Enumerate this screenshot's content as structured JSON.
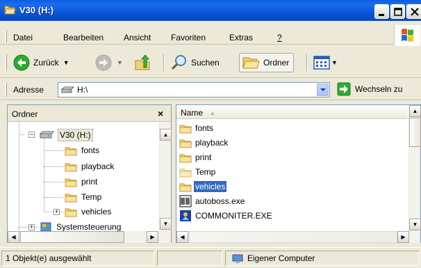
{
  "window": {
    "title": "V30 (H:)"
  },
  "colors": {
    "titlebar": "#0a55d8",
    "selection": "#316ac5",
    "chrome": "#ece9d8"
  },
  "menu": {
    "items": [
      "Datei",
      "Bearbeiten",
      "Ansicht",
      "Favoriten",
      "Extras",
      "?"
    ]
  },
  "toolbar": {
    "back_label": "Zurück",
    "search_label": "Suchen",
    "folders_label": "Ordner"
  },
  "address": {
    "label": "Adresse",
    "value": "H:\\",
    "go_label": "Wechseln zu"
  },
  "folder_pane": {
    "title": "Ordner",
    "close_label": "×",
    "tree": [
      {
        "label": "V30 (H:)",
        "icon": "drive-icon",
        "selected": true
      },
      {
        "label": "fonts",
        "icon": "folder-icon"
      },
      {
        "label": "playback",
        "icon": "folder-icon"
      },
      {
        "label": "print",
        "icon": "folder-icon"
      },
      {
        "label": "Temp",
        "icon": "folder-icon"
      },
      {
        "label": "vehicles",
        "icon": "folder-icon"
      },
      {
        "label": "Systemsteuerung",
        "icon": "control-panel-icon"
      }
    ]
  },
  "file_pane": {
    "column_name": "Name",
    "files": [
      {
        "label": "fonts",
        "icon": "folder-icon"
      },
      {
        "label": "playback",
        "icon": "folder-icon"
      },
      {
        "label": "print",
        "icon": "folder-icon"
      },
      {
        "label": "Temp",
        "icon": "folder-icon"
      },
      {
        "label": "vehicles",
        "icon": "folder-icon",
        "selected": true
      },
      {
        "label": "autoboss.exe",
        "icon": "exe-icon"
      },
      {
        "label": "COMMONITER.EXE",
        "icon": "exe-icon"
      }
    ]
  },
  "status": {
    "selection": "1 Objekt(e) ausgewählt",
    "location": "Eigener Computer"
  }
}
